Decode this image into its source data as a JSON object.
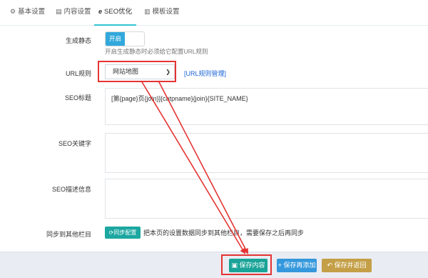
{
  "tabs": [
    {
      "icon": "gear-icon",
      "glyph": "⚙",
      "label": "基本设置"
    },
    {
      "icon": "table-icon",
      "glyph": "▤",
      "label": "内容设置"
    },
    {
      "icon": "ie-icon",
      "glyph": "e",
      "label": "SEO优化",
      "active": true
    },
    {
      "icon": "template-icon",
      "glyph": "▥",
      "label": "模板设置"
    }
  ],
  "form": {
    "static": {
      "label": "生成静态",
      "toggle_on": "开启",
      "help": "开启生成静态时必须给它配置URL规则"
    },
    "url_rule": {
      "label": "URL规则",
      "selected": "网站地图",
      "manage_link": "[URL规则管理]"
    },
    "seo_title": {
      "label": "SEO标题",
      "value": "[第{page}页{join}]{catpname}{join}{SITE_NAME}"
    },
    "seo_keywords": {
      "label": "SEO关键字",
      "value": ""
    },
    "seo_description": {
      "label": "SEO描述信息",
      "value": ""
    },
    "sync": {
      "label": "同步到其他栏目",
      "button": "同步配置",
      "text": "把本页的设置数据同步到其他栏目，需要保存之后再同步"
    }
  },
  "footer": {
    "save": "保存内容",
    "save_add": "保存再添加",
    "save_back": "保存并返回"
  },
  "colors": {
    "accent": "#32c5d2",
    "highlight": "#e53333",
    "save": "#1aa398",
    "save_add": "#3598dc",
    "save_back": "#c49f47"
  }
}
